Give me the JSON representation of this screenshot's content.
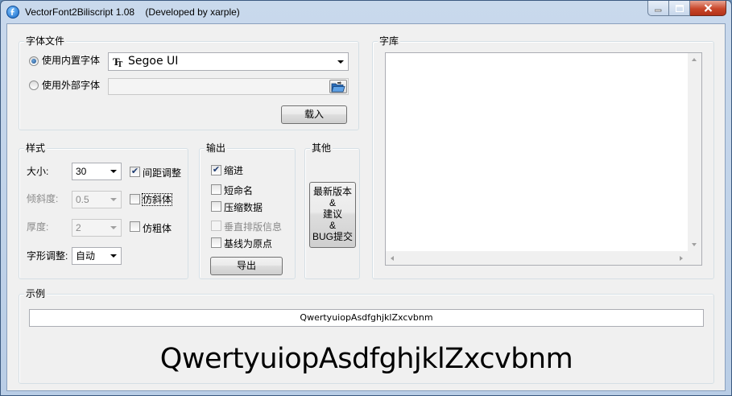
{
  "window": {
    "title": "VectorFont2Biliscript 1.08    (Developed by xarple)"
  },
  "font_file": {
    "title": "字体文件",
    "builtin_label": "使用内置字体",
    "builtin_checked": true,
    "builtin_font": "Segoe UI",
    "external_label": "使用外部字体",
    "external_path": "",
    "load_button": "载入"
  },
  "style": {
    "title": "样式",
    "size_label": "大小:",
    "size_value": "30",
    "spacing_label": "间距调整",
    "spacing_checked": true,
    "skew_label": "倾斜度:",
    "skew_value": "0.5",
    "italic_label": "仿斜体",
    "italic_checked": false,
    "thickness_label": "厚度:",
    "thickness_value": "2",
    "bold_label": "仿粗体",
    "bold_checked": false,
    "shape_label": "字形调整:",
    "shape_value": "自动"
  },
  "output": {
    "title": "输出",
    "indent_label": "缩进",
    "indent_checked": true,
    "short_name_label": "短命名",
    "short_name_checked": false,
    "compress_label": "压缩数据",
    "compress_checked": false,
    "vertical_label": "垂直排版信息",
    "vertical_checked": false,
    "baseline_label": "基线为原点",
    "baseline_checked": false,
    "export_button": "导出"
  },
  "other": {
    "title": "其他",
    "button_lines": [
      "最新版本",
      "&",
      "建议",
      "&",
      "BUG提交"
    ]
  },
  "library": {
    "title": "字库"
  },
  "sample": {
    "title": "示例",
    "input_value": "QwertyuiopAsdfghjklZxcvbnm",
    "preview_text": "QwertyuiopAsdfghjklZxcvbnm"
  },
  "colors": {
    "titlebar": "#c9d9ec",
    "close_button": "#c8462a",
    "client_bg": "#f0f0f0"
  },
  "icons": {
    "app": "app-logo-icon",
    "font_type": "truetype-icon",
    "folder": "open-folder-icon"
  }
}
